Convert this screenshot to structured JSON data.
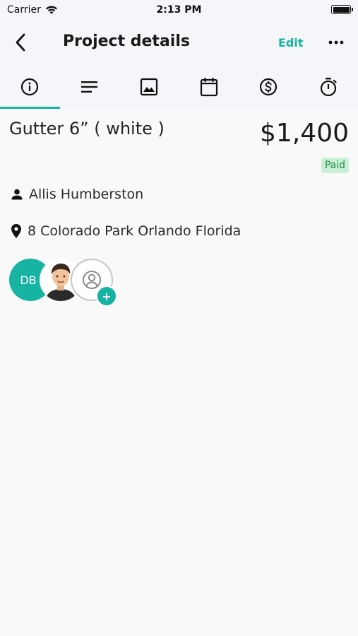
{
  "status_bar": {
    "carrier": "Carrier",
    "time": "2:13 PM",
    "wifi_icon": "wifi-icon",
    "battery_icon": "battery-icon"
  },
  "header": {
    "title": "Project details",
    "back_icon": "chevron-left-icon",
    "edit_label": "Edit",
    "more_icon": "ellipsis-icon"
  },
  "tabs": [
    {
      "icon": "info-icon",
      "active": true
    },
    {
      "icon": "notes-icon",
      "active": false
    },
    {
      "icon": "image-icon",
      "active": false
    },
    {
      "icon": "calendar-icon",
      "active": false
    },
    {
      "icon": "dollar-icon",
      "active": false
    },
    {
      "icon": "stopwatch-icon",
      "active": false
    }
  ],
  "job": {
    "title": "Gutter 6” ( white )",
    "price": "$1,400",
    "status": "Paid"
  },
  "client": {
    "name": "Allis Humberston",
    "icon": "person-icon"
  },
  "location": {
    "address": "8 Colorado Park Orlando Florida",
    "icon": "location-pin-icon"
  },
  "team": {
    "initials": "DB",
    "add_symbol": "+"
  },
  "colors": {
    "accent": "#17b3a3",
    "badge_bg": "#c9f0d6",
    "badge_text": "#1e8a4a",
    "header_bg": "#f4f6f9",
    "page_bg": "#f9f9f9"
  }
}
